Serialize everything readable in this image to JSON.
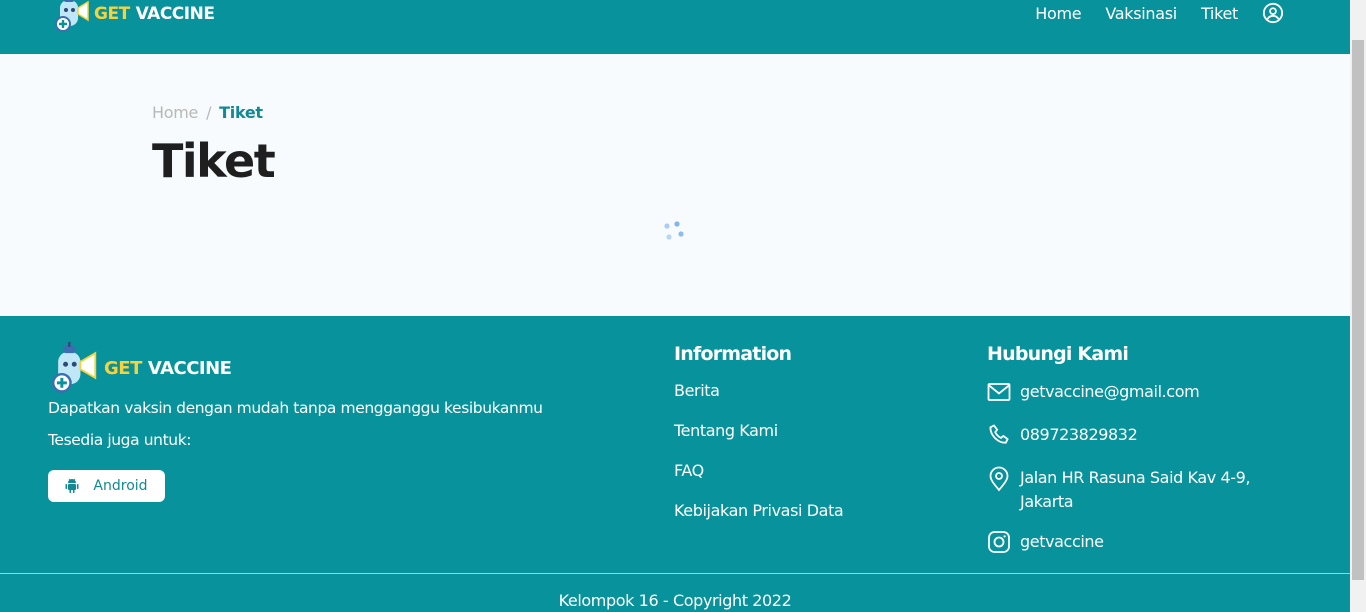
{
  "brand": {
    "logo_get": "GET",
    "logo_vaccine": "VACCINE",
    "colors": {
      "primary": "#08929c",
      "accent": "#f6d33c",
      "title": "#1f1f1f"
    }
  },
  "nav": {
    "items": [
      {
        "label": "Home"
      },
      {
        "label": "Vaksinasi"
      },
      {
        "label": "Tiket"
      }
    ],
    "user_icon": "user-circle-icon"
  },
  "breadcrumb": {
    "home": "Home",
    "separator": "/",
    "current": "Tiket"
  },
  "page": {
    "title": "Tiket",
    "loading_icon": "spinner-dots-icon"
  },
  "footer": {
    "description": "Dapatkan vaksin dengan mudah tanpa mengganggu kesibukanmu",
    "available": "Tesedia juga untuk:",
    "android_label": "Android",
    "info": {
      "title": "Information",
      "links": [
        "Berita",
        "Tentang Kami",
        "FAQ",
        "Kebijakan Privasi Data"
      ]
    },
    "contact": {
      "title": "Hubungi Kami",
      "email": "getvaccine@gmail.com",
      "phone": "089723829832",
      "address": "Jalan HR Rasuna Said Kav 4-9, Jakarta",
      "instagram": "getvaccine"
    },
    "copyright": "Kelompok 16 - Copyright 2022"
  }
}
